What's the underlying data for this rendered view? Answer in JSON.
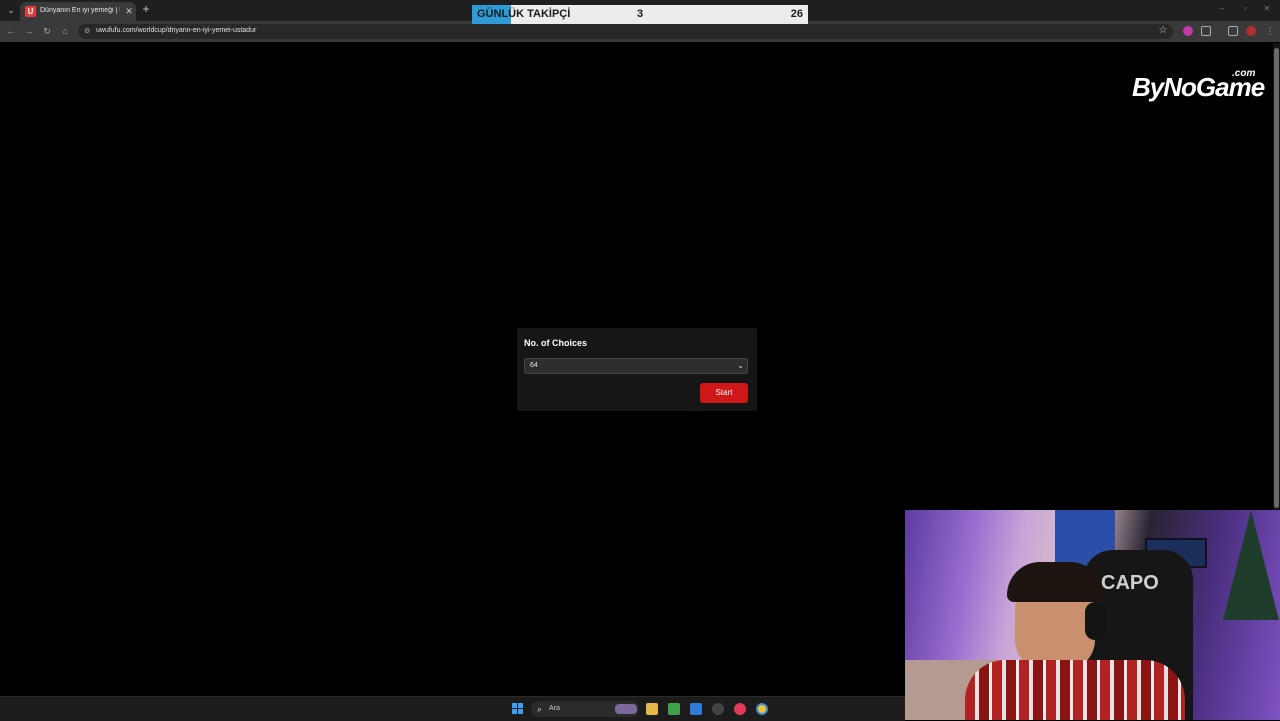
{
  "browser": {
    "tab_title": "Dünyanın En iyi yemeği | UwUf",
    "tab_favicon_letter": "U",
    "url": "uwufufu.com/worldcup/dnyann-en-iyi-yemei-ustadur"
  },
  "follower_goal": {
    "label": "GÜNLÜK TAKİPÇİ",
    "current": "3",
    "goal": "26",
    "progress_fraction": 0.115,
    "fill_color": "#2e9bd6"
  },
  "page": {
    "logo_text": "ByNoGame",
    "logo_suffix": ".com",
    "choices": {
      "title": "No. of Choices",
      "selected_value": "64",
      "start_label": "Start",
      "start_color": "#d01818"
    }
  },
  "webcam": {
    "chair_text": "CAPO"
  },
  "taskbar": {
    "search_placeholder": "Ara"
  }
}
